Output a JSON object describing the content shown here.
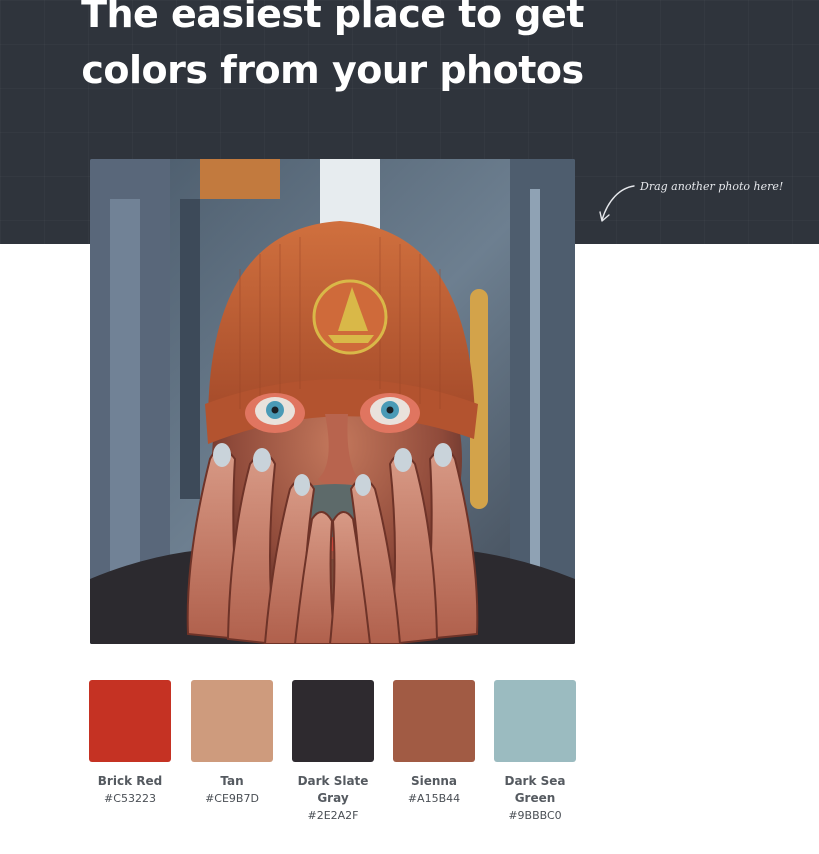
{
  "hero": {
    "headline_line1": "The easiest place to get",
    "headline_line2": "colors from your photos",
    "drop_hint": "Drag another photo here!"
  },
  "photo": {
    "hat_text": ""
  },
  "palette": [
    {
      "name": "Brick Red",
      "hex": "#C53223",
      "color": "#C53223"
    },
    {
      "name": "Tan",
      "hex": "#CE9B7D",
      "color": "#CE9B7D"
    },
    {
      "name": "Dark Slate Gray",
      "hex": "#2E2A2F",
      "color": "#2E2A2F"
    },
    {
      "name": "Sienna",
      "hex": "#A15B44",
      "color": "#A15B44"
    },
    {
      "name": "Dark Sea Green",
      "hex": "#9BBBC0",
      "color": "#9BBBC0"
    }
  ],
  "colors": {
    "hero_bg": "#2f343c",
    "headline": "#ffffff"
  }
}
